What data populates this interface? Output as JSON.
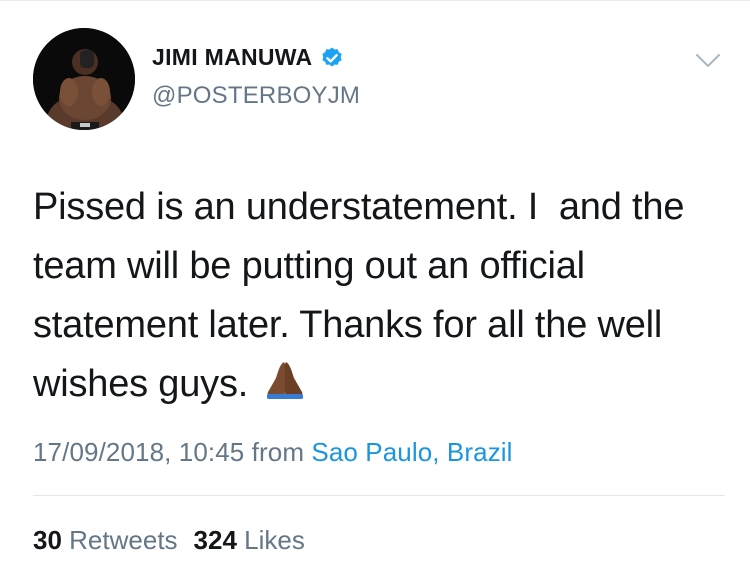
{
  "user": {
    "display_name": "JIMI MANUWA",
    "handle": "@POSTERBOYJM",
    "verified": true,
    "avatar_icon": "profile-photo"
  },
  "tweet": {
    "text": "Pissed is an understatement. I  and the team will be putting out an official statement later. Thanks for all the well wishes guys.",
    "emoji": "folded-hands-icon",
    "timestamp": "17/09/2018, 10:45",
    "from_label": "from",
    "location": "Sao Paulo, Brazil"
  },
  "stats": {
    "retweets_count": "30",
    "retweets_label": "Retweets",
    "likes_count": "324",
    "likes_label": "Likes"
  },
  "colors": {
    "link": "#1b95e0",
    "secondary_text": "#657786",
    "primary_text": "#14171a",
    "verified_badge": "#1da1f2"
  }
}
